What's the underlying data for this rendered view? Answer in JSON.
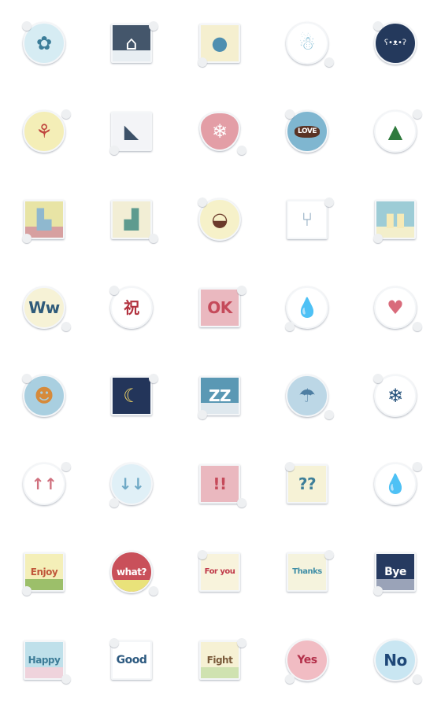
{
  "stickers": [
    {
      "name": "flower-cloud",
      "shape": "circle",
      "bg": "#d6ecf3",
      "fg": "#3b7d99",
      "glyph": "✿"
    },
    {
      "name": "snowy-house",
      "shape": "square",
      "bg": "#44566b",
      "fg": "#ffffff",
      "glyph": "⌂",
      "band": "#e8eef2"
    },
    {
      "name": "blue-tree",
      "shape": "square",
      "bg": "#f5efcf",
      "fg": "#4f8fb0",
      "glyph": "●"
    },
    {
      "name": "snowman",
      "shape": "circle",
      "bg": "#ffffff",
      "fg": "#8fc3d9",
      "glyph": "☃"
    },
    {
      "name": "polar-bear",
      "shape": "circle",
      "bg": "#24395c",
      "fg": "#ffffff",
      "glyph": "ʕ•ᴥ•ʔ"
    },
    {
      "name": "tulips",
      "shape": "circle",
      "bg": "#f4eeb7",
      "fg": "#c0473f",
      "glyph": "⚘"
    },
    {
      "name": "bird",
      "shape": "square",
      "bg": "#f3f4f7",
      "fg": "#3d5168",
      "glyph": "◣"
    },
    {
      "name": "mittens",
      "shape": "heart",
      "bg": "#e39ea6",
      "fg": "#ffffff",
      "glyph": "❄"
    },
    {
      "name": "love-cookie",
      "shape": "circle",
      "bg": "#7fb6d0",
      "fg": "#ffffff",
      "text": "LOVE",
      "textbg": "#5a3325"
    },
    {
      "name": "christmas-tree",
      "shape": "circle",
      "bg": "#ffffff",
      "fg": "#2f7a3d",
      "glyph": "▲"
    },
    {
      "name": "elephant-house",
      "shape": "square",
      "bg": "#e8e4a5",
      "fg": "#8fb8cf",
      "glyph": "▙",
      "band": "#d7a0a0"
    },
    {
      "name": "green-cat-house",
      "shape": "square",
      "bg": "#f2eed5",
      "fg": "#5e9b8f",
      "glyph": "▟"
    },
    {
      "name": "strawberry-cake",
      "shape": "circle",
      "bg": "#f6f1c9",
      "fg": "#6b3a2b",
      "glyph": "◒"
    },
    {
      "name": "spoon-fork",
      "shape": "square",
      "bg": "#ffffff",
      "fg": "#8aa6bd",
      "glyph": "⑂"
    },
    {
      "name": "candles",
      "shape": "square",
      "bg": "#9dccd6",
      "fg": "#f6eab6",
      "glyph": "▮▮",
      "band": "#f3efcb"
    },
    {
      "name": "ww-circle",
      "shape": "circle",
      "bg": "#f6f2d6",
      "fg": "#2f5b7a",
      "text": "Ww"
    },
    {
      "name": "celebrate-kanji",
      "shape": "circle",
      "bg": "#ffffff",
      "fg": "#b2323f",
      "text": "祝"
    },
    {
      "name": "ok-sign",
      "shape": "square",
      "bg": "#eab8bf",
      "fg": "#c54a5a",
      "text": "OK"
    },
    {
      "name": "raindrops",
      "shape": "circle",
      "bg": "#ffffff",
      "fg": "#4f8fb0",
      "glyph": "💧"
    },
    {
      "name": "pink-heart",
      "shape": "circle",
      "bg": "#ffffff",
      "fg": "#d96b7b",
      "glyph": "♥"
    },
    {
      "name": "sun-face",
      "shape": "circle",
      "bg": "#a9cfe0",
      "fg": "#d68a3a",
      "glyph": "☻"
    },
    {
      "name": "moon-night",
      "shape": "square",
      "bg": "#23355a",
      "fg": "#f3d664",
      "glyph": "☾"
    },
    {
      "name": "zz-sleep",
      "shape": "square",
      "bg": "#5a98b4",
      "fg": "#ffffff",
      "text": "ZZ",
      "band": "#dfe8ee"
    },
    {
      "name": "umbrella",
      "shape": "circle",
      "bg": "#bcd7e6",
      "fg": "#4f7fa3",
      "glyph": "☂"
    },
    {
      "name": "snowflake",
      "shape": "circle",
      "bg": "#ffffff",
      "fg": "#23507a",
      "glyph": "❄"
    },
    {
      "name": "up-arrows",
      "shape": "circle",
      "bg": "#ffffff",
      "fg": "#d0707e",
      "text": "↑↑"
    },
    {
      "name": "down-arrows",
      "shape": "circle",
      "bg": "#e0f0f7",
      "fg": "#6fa9c6",
      "text": "↓↓"
    },
    {
      "name": "footprints-exclaim",
      "shape": "square",
      "bg": "#eab8bf",
      "fg": "#c54a5a",
      "text": "!!"
    },
    {
      "name": "question-marks",
      "shape": "square",
      "bg": "#f6f2d6",
      "fg": "#3e7f99",
      "text": "??"
    },
    {
      "name": "droplets",
      "shape": "circle",
      "bg": "#ffffff",
      "fg": "#5d9cc0",
      "glyph": "💧"
    },
    {
      "name": "enjoy-sticker",
      "shape": "square",
      "bg": "#f4efb8",
      "fg": "#c0573a",
      "text": "Enjoy",
      "band": "#9cbf6a"
    },
    {
      "name": "what-apple",
      "shape": "circle",
      "bg": "#c9505a",
      "fg": "#ffffff",
      "text": "what?",
      "band": "#e9e27a"
    },
    {
      "name": "for-you-card",
      "shape": "square",
      "bg": "#f8f3dc",
      "fg": "#c03a4a",
      "text": "For you"
    },
    {
      "name": "thanks-card",
      "shape": "square",
      "bg": "#f5f3dd",
      "fg": "#3f8ea6",
      "text": "Thanks"
    },
    {
      "name": "bye-night",
      "shape": "square",
      "bg": "#263a60",
      "fg": "#ffffff",
      "text": "Bye",
      "band": "#9aa3b8"
    },
    {
      "name": "happy-card",
      "shape": "square",
      "bg": "#bfe0ea",
      "fg": "#3d7c97",
      "text": "Happy",
      "band": "#efd3dc"
    },
    {
      "name": "good-card",
      "shape": "square",
      "bg": "#ffffff",
      "fg": "#2d5a80",
      "text": "Good"
    },
    {
      "name": "fight-card",
      "shape": "square",
      "bg": "#f6f1d4",
      "fg": "#7a5a3a",
      "text": "Fight",
      "band": "#cfe2b0"
    },
    {
      "name": "yes-bubble",
      "shape": "circle",
      "bg": "#f1bcc3",
      "fg": "#b3304a",
      "text": "Yes"
    },
    {
      "name": "no-bubble",
      "shape": "circle",
      "bg": "#c9e6f2",
      "fg": "#1f4878",
      "text": "No"
    }
  ]
}
